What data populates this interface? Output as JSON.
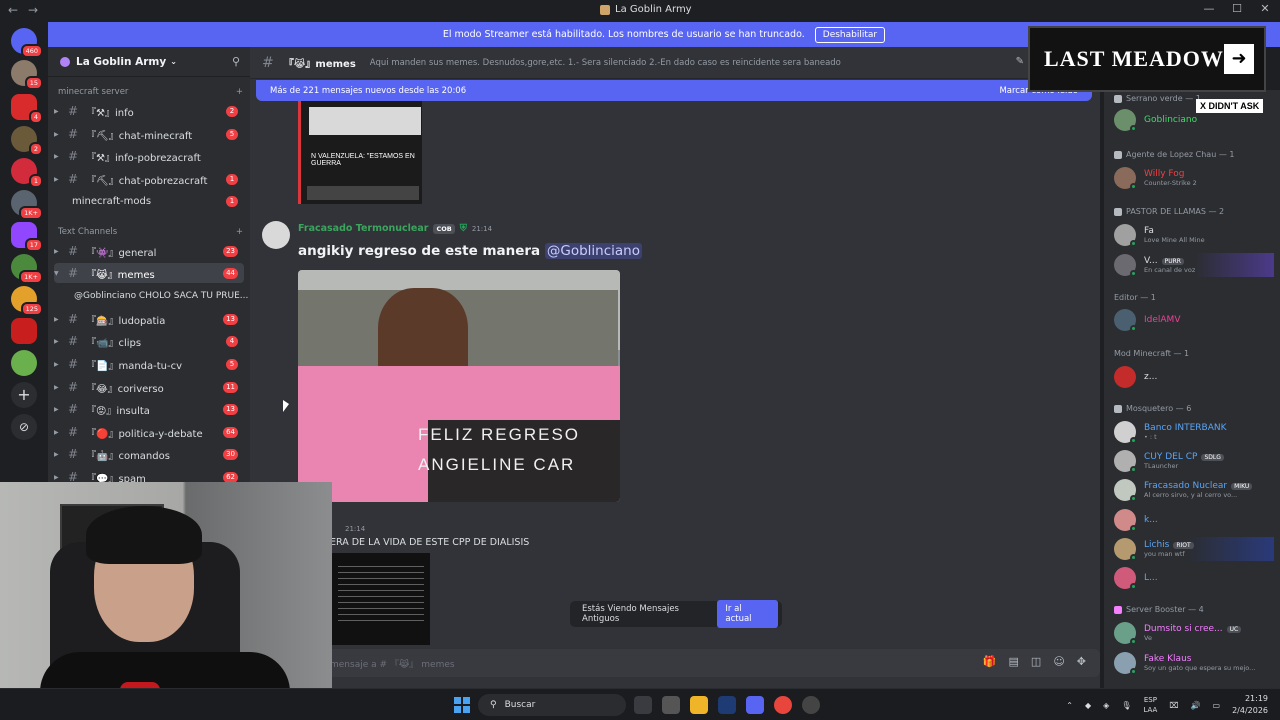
{
  "window": {
    "title": "La Goblin Army",
    "controls": [
      "—",
      "☐",
      "✕"
    ]
  },
  "banner": {
    "text": "El modo Streamer está habilitado. Los nombres de usuario se han truncado.",
    "button": "Deshabilitar"
  },
  "guild_badges": [
    "460",
    "15",
    "4",
    "2",
    "1",
    "1K+",
    "17",
    "1K+",
    "125"
  ],
  "server": {
    "name": "La Goblin Army"
  },
  "categories": {
    "minecraft": "minecraft server",
    "text": "Text Channels"
  },
  "channels": [
    {
      "name": "『⚒』info",
      "count": "2"
    },
    {
      "name": "『⛏』chat-minecraft",
      "count": "5"
    },
    {
      "name": "『⚒』info-pobrezacraft",
      "count": ""
    },
    {
      "name": "『⛏』chat-pobrezacraft",
      "count": "1"
    },
    {
      "name": "minecraft-mods",
      "count": "1"
    },
    {
      "name": "『👾』general",
      "count": "23"
    },
    {
      "name": "『😹』memes",
      "count": "44"
    },
    {
      "name": "『🎰』ludopatia",
      "count": "13"
    },
    {
      "name": "『📹』clips",
      "count": "4"
    },
    {
      "name": "『📄』manda-tu-cv",
      "count": "5"
    },
    {
      "name": "『😂』coriverso",
      "count": "11"
    },
    {
      "name": "『😡』insulta",
      "count": "13"
    },
    {
      "name": "『🔴』politica-y-debate",
      "count": "64"
    },
    {
      "name": "『🤖』comandos",
      "count": "30"
    },
    {
      "name": "『💬』spam",
      "count": "62"
    }
  ],
  "thread": "@Goblinciano CHOLO SACA TU PRUE...",
  "header": {
    "channel": "『😹』memes",
    "topic": "Aqui manden sus memes. Desnudos,gore,etc. 1.- Sera silenciado 2.-En dado caso es reincidente sera baneado"
  },
  "newbar": {
    "left": "Más de 221 mensajes nuevos desde las 20:06",
    "right": "Marcar como leído"
  },
  "messages": {
    "img1_caption": "N VALENZUELA: \"ESTAMOS EN GUERRA",
    "author": "Fracasado Termonuclear",
    "author_tag": "COB",
    "time": "21:14",
    "text": "angikiy regreso de este manera",
    "mention": "@Goblinciano",
    "photo_text": "FELIZ REGRESO\nANGIELINE CAR",
    "msg2_time": "21:14",
    "msg2_text": "ERA DE LA VIDA DE ESTE CPP DE DIALISIS"
  },
  "old_messages": {
    "label": "Estás Viendo Mensajes Antiguos",
    "button": "Ir al actual"
  },
  "composer": {
    "placeholder": "mensaje a # 『😹』 memes"
  },
  "game_banner": {
    "title": "LAST MEADOW",
    "overlay": "X DIDN'T ASK"
  },
  "members": {
    "groups": [
      {
        "label": "Serrano verde — 1",
        "members": [
          {
            "name": "Goblinciano",
            "color": "#43d96b",
            "activity": ""
          }
        ]
      },
      {
        "label": "Agente de Lopez Chau — 1",
        "members": [
          {
            "name": "Willy Fog",
            "color": "#f23f43",
            "activity": "Counter-Strike 2"
          }
        ]
      },
      {
        "label": "PASTOR DE LLAMAS — 2",
        "members": [
          {
            "name": "Fa",
            "color": "#dbdee1",
            "activity": "Love Mine All Mine"
          },
          {
            "name": "V...",
            "color": "#dbdee1",
            "tag": "PURR",
            "activity": "En canal de voz"
          }
        ]
      },
      {
        "label": "Editor — 1",
        "members": [
          {
            "name": "IdelAMV",
            "color": "#f23f97",
            "activity": ""
          }
        ]
      },
      {
        "label": "Mod Minecraft — 1",
        "members": [
          {
            "name": "z...",
            "color": "#dbdee1",
            "activity": ""
          }
        ]
      },
      {
        "label": "Mosquetero — 6",
        "members": [
          {
            "name": "Banco INTERBANK",
            "color": "#5aa4f5",
            "activity": "• : t"
          },
          {
            "name": "CUY DEL CP",
            "color": "#5aa4f5",
            "tag": "SDLG",
            "activity": "TLauncher"
          },
          {
            "name": "Fracasado Nuclear",
            "color": "#5aa4f5",
            "tag": "MIKU",
            "activity": "Al cerro sirvo, y al cerro vo..."
          },
          {
            "name": "k...",
            "color": "#5aa4f5",
            "activity": ""
          },
          {
            "name": "Lichis",
            "color": "#5aa4f5",
            "tag": "RIOT",
            "activity": "you man wtf"
          },
          {
            "name": "L...",
            "color": "#5aa4f5",
            "activity": ""
          }
        ]
      },
      {
        "label": "Server Booster — 4",
        "members": [
          {
            "name": "Dumsito si cree...",
            "color": "#f47fff",
            "tag": "UC",
            "activity": "Ve"
          },
          {
            "name": "Fake Klaus",
            "color": "#f47fff",
            "activity": "Soy un gato que espera su mejo..."
          }
        ]
      }
    ]
  },
  "taskbar": {
    "search": "Buscar",
    "lang_top": "ESP",
    "lang_bottom": "LAA",
    "time": "21:19",
    "date": "2/4/2026"
  }
}
